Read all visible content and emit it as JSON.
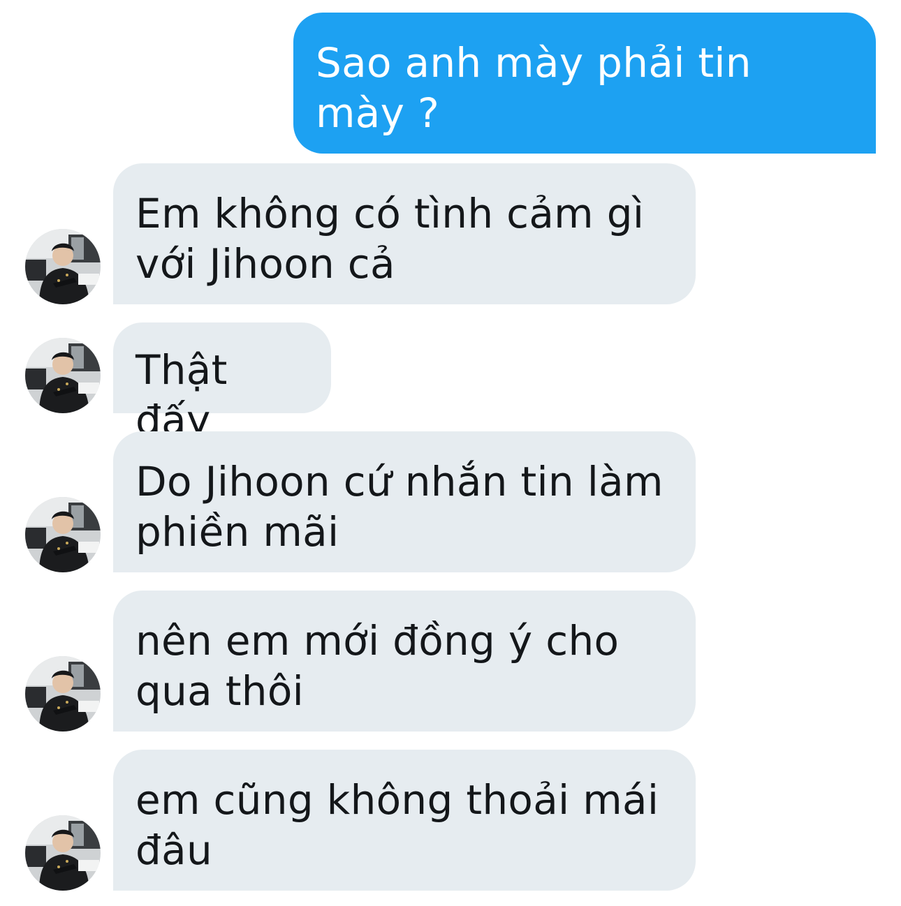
{
  "conversation": {
    "messages": [
      {
        "direction": "sent",
        "text": "Sao anh mày phải tin\nmày ?"
      },
      {
        "direction": "received",
        "text": "Em không có tình cảm gì\nvới Jihoon cả"
      },
      {
        "direction": "received",
        "text": "Thật đấy"
      },
      {
        "direction": "received",
        "text": "Do Jihoon cứ nhắn tin làm\nphiền mãi"
      },
      {
        "direction": "received",
        "text": "nên em mới đồng ý cho\nqua thôi"
      },
      {
        "direction": "received",
        "text": "em cũng không thoải mái\nđâu"
      }
    ]
  },
  "colors": {
    "sent_bubble": "#1da1f2",
    "received_bubble": "#e6ecf0",
    "received_text": "#14171a"
  },
  "avatar": {
    "icon": "user-avatar-photo"
  }
}
